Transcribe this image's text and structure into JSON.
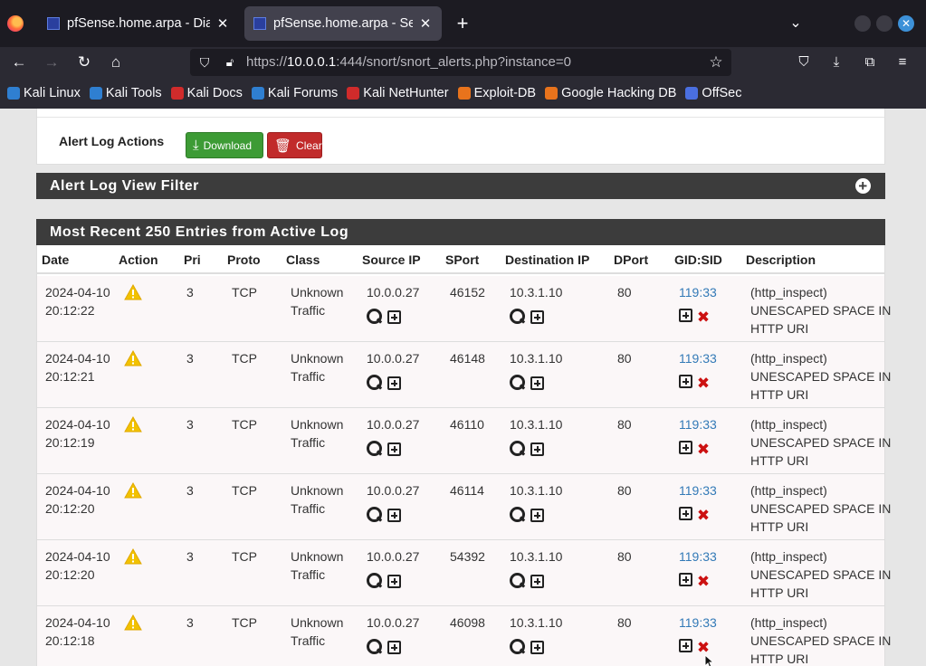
{
  "browser": {
    "tabs": [
      {
        "title": "pfSense.home.arpa - Diag",
        "active": false
      },
      {
        "title": "pfSense.home.arpa - Serv",
        "active": true
      }
    ],
    "url_prefix": "https://",
    "url_host": "10.0.0.1",
    "url_rest": ":444/snort/snort_alerts.php?instance=0",
    "bookmarks": [
      {
        "label": "Kali Linux",
        "color": "#2f7fd1"
      },
      {
        "label": "Kali Tools",
        "color": "#2f7fd1"
      },
      {
        "label": "Kali Docs",
        "color": "#d02b2b"
      },
      {
        "label": "Kali Forums",
        "color": "#2f7fd1"
      },
      {
        "label": "Kali NetHunter",
        "color": "#d02b2b"
      },
      {
        "label": "Exploit-DB",
        "color": "#e8731c"
      },
      {
        "label": "Google Hacking DB",
        "color": "#e8731c"
      },
      {
        "label": "OffSec",
        "color": "#4a6fe0"
      }
    ]
  },
  "actions": {
    "label": "Alert Log Actions",
    "download_label": "Download",
    "clear_label": "Clear"
  },
  "filter_panel": {
    "title": "Alert Log View Filter"
  },
  "log_panel": {
    "title": "Most Recent 250 Entries from Active Log",
    "columns": [
      "Date",
      "Action",
      "Pri",
      "Proto",
      "Class",
      "Source IP",
      "SPort",
      "Destination IP",
      "DPort",
      "GID:SID",
      "Description"
    ],
    "rows": [
      {
        "date": "2024-04-10",
        "time": "20:12:22",
        "pri": "3",
        "proto": "TCP",
        "class1": "Unknown",
        "class2": "Traffic",
        "src": "10.0.0.27",
        "sport": "46152",
        "dst": "10.3.1.10",
        "dport": "80",
        "sid": "119:33",
        "desc1": "(http_inspect)",
        "desc2": "UNESCAPED SPACE IN",
        "desc3": "HTTP URI"
      },
      {
        "date": "2024-04-10",
        "time": "20:12:21",
        "pri": "3",
        "proto": "TCP",
        "class1": "Unknown",
        "class2": "Traffic",
        "src": "10.0.0.27",
        "sport": "46148",
        "dst": "10.3.1.10",
        "dport": "80",
        "sid": "119:33",
        "desc1": "(http_inspect)",
        "desc2": "UNESCAPED SPACE IN",
        "desc3": "HTTP URI"
      },
      {
        "date": "2024-04-10",
        "time": "20:12:19",
        "pri": "3",
        "proto": "TCP",
        "class1": "Unknown",
        "class2": "Traffic",
        "src": "10.0.0.27",
        "sport": "46110",
        "dst": "10.3.1.10",
        "dport": "80",
        "sid": "119:33",
        "desc1": "(http_inspect)",
        "desc2": "UNESCAPED SPACE IN",
        "desc3": "HTTP URI"
      },
      {
        "date": "2024-04-10",
        "time": "20:12:20",
        "pri": "3",
        "proto": "TCP",
        "class1": "Unknown",
        "class2": "Traffic",
        "src": "10.0.0.27",
        "sport": "46114",
        "dst": "10.3.1.10",
        "dport": "80",
        "sid": "119:33",
        "desc1": "(http_inspect)",
        "desc2": "UNESCAPED SPACE IN",
        "desc3": "HTTP URI"
      },
      {
        "date": "2024-04-10",
        "time": "20:12:20",
        "pri": "3",
        "proto": "TCP",
        "class1": "Unknown",
        "class2": "Traffic",
        "src": "10.0.0.27",
        "sport": "54392",
        "dst": "10.3.1.10",
        "dport": "80",
        "sid": "119:33",
        "desc1": "(http_inspect)",
        "desc2": "UNESCAPED SPACE IN",
        "desc3": "HTTP URI"
      },
      {
        "date": "2024-04-10",
        "time": "20:12:18",
        "pri": "3",
        "proto": "TCP",
        "class1": "Unknown",
        "class2": "Traffic",
        "src": "10.0.0.27",
        "sport": "46098",
        "dst": "10.3.1.10",
        "dport": "80",
        "sid": "119:33",
        "desc1": "(http_inspect)",
        "desc2": "UNESCAPED SPACE IN",
        "desc3": "HTTP URI"
      }
    ]
  },
  "icons": {
    "action_warning": "warning-triangle-icon",
    "lookup": "magnifier-icon",
    "add": "square-plus-icon",
    "delete": "red-x-icon",
    "filter_expand": "plus-circle-icon"
  },
  "colors": {
    "panel_header": "#3c3c3c",
    "download_button": "#3d9b35",
    "clear_button": "#c12b2b",
    "link": "#337ab7",
    "warning": "#f2c200"
  }
}
